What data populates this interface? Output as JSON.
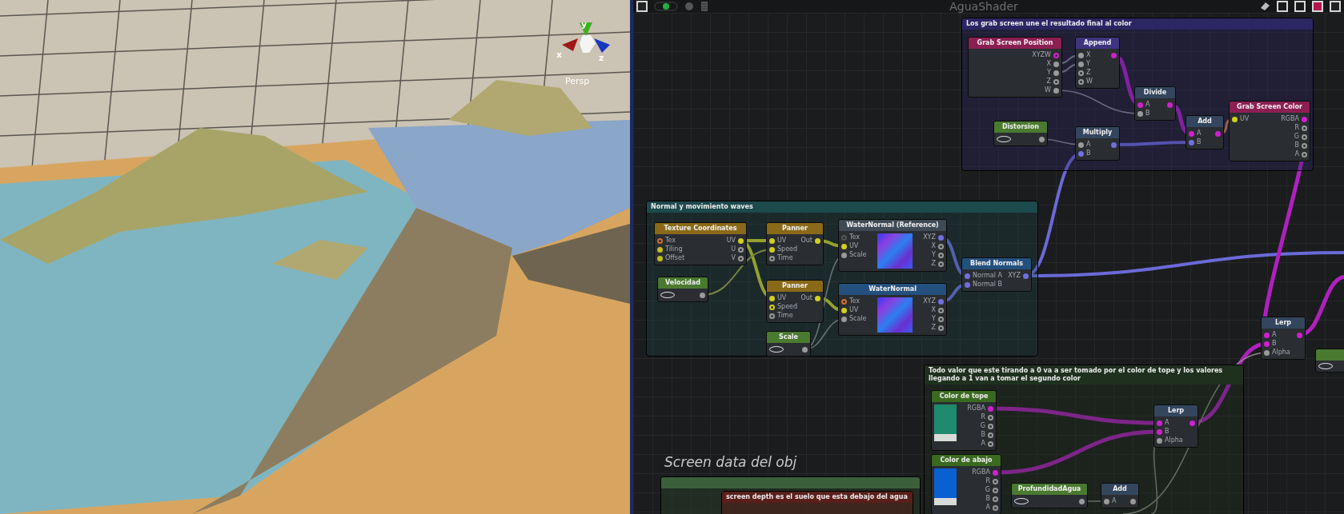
{
  "viewport": {
    "projection_label": "Persp",
    "gizmo_axes": [
      {
        "label": "y"
      },
      {
        "label": "x"
      },
      {
        "label": "z"
      }
    ]
  },
  "editor": {
    "title": "AguaShader"
  },
  "groups": [
    {
      "title": "Los grab screen une el resultado final al color",
      "color": "#2c2664"
    },
    {
      "title": "Normal y movimiento waves",
      "color": "#1d4a4c"
    },
    {
      "title": "Todo valor que este tirando a 0 va a ser tomado por el color de tope y los valores llegando a 1 van a tomar el segundo color",
      "color": "#1f301f"
    },
    {
      "color": "#3b5f3b"
    },
    {
      "title": "screen depth es el suelo que esta debajo del agua",
      "color": "#5a1f1a"
    }
  ],
  "floating_label": "Screen data del obj",
  "nodes": [
    {
      "kind": "basic",
      "title": "Grab Screen Position",
      "color": "#8c1f52",
      "outputs": [
        {
          "label": "XYZW",
          "color": "#d020d0",
          "connected": false
        },
        {
          "label": "X",
          "color": "#9a9a9a",
          "connected": true
        },
        {
          "label": "Y",
          "color": "#9a9a9a",
          "connected": true
        },
        {
          "label": "Z",
          "color": "#9a9a9a",
          "connected": false
        },
        {
          "label": "W",
          "color": "#9a9a9a",
          "connected": true
        }
      ]
    },
    {
      "kind": "basic",
      "title": "Append",
      "color": "#3e3480",
      "inputs": [
        {
          "label": "X",
          "color": "#9a9a9a",
          "connected": true
        },
        {
          "label": "Y",
          "color": "#9a9a9a",
          "connected": true
        },
        {
          "label": "Z",
          "color": "#9a9a9a",
          "connected": false
        },
        {
          "label": "W",
          "color": "#9a9a9a",
          "connected": false
        }
      ],
      "outputs": [
        {
          "color": "#d020d0",
          "connected": true
        }
      ]
    },
    {
      "kind": "basic",
      "title": "Divide",
      "color": "#34465e",
      "inputs": [
        {
          "label": "A",
          "color": "#d020d0",
          "connected": true
        },
        {
          "label": "B",
          "color": "#9a9a9a",
          "connected": true
        }
      ],
      "outputs": [
        {
          "color": "#d020d0",
          "connected": true
        }
      ]
    },
    {
      "kind": "basic",
      "title": "Add",
      "color": "#34465e",
      "inputs": [
        {
          "label": "A",
          "color": "#d020d0",
          "connected": true
        },
        {
          "label": "B",
          "color": "#7070e0",
          "connected": true
        }
      ],
      "outputs": [
        {
          "color": "#d020d0",
          "connected": true
        }
      ]
    },
    {
      "kind": "basic",
      "title": "Grab Screen Color",
      "color": "#8c1f52",
      "inputs": [
        {
          "label": "UV",
          "color": "#d0d020",
          "connected": true
        }
      ],
      "outputs": [
        {
          "label": "RGBA",
          "color": "#d020d0",
          "connected": true
        },
        {
          "label": "R",
          "color": "#9a9a9a",
          "connected": false
        },
        {
          "label": "G",
          "color": "#9a9a9a",
          "connected": false
        },
        {
          "label": "B",
          "color": "#9a9a9a",
          "connected": false
        },
        {
          "label": "A",
          "color": "#9a9a9a",
          "connected": false
        }
      ]
    },
    {
      "kind": "value",
      "title": "Distorsion",
      "color": "#4a7a30",
      "outputs": [
        {
          "color": "#9a9a9a",
          "connected": true
        }
      ]
    },
    {
      "kind": "basic",
      "title": "Multiply",
      "color": "#34465e",
      "inputs": [
        {
          "label": "A",
          "color": "#9a9a9a",
          "connected": true
        },
        {
          "label": "B",
          "color": "#7070e0",
          "connected": true
        }
      ],
      "outputs": [
        {
          "color": "#7070e0",
          "connected": true
        }
      ]
    },
    {
      "kind": "basic",
      "title": "Texture Coordinates",
      "color": "#8a6a18",
      "inputs": [
        {
          "label": "Tex",
          "color": "#d07030",
          "connected": false
        },
        {
          "label": "Tiling",
          "color": "#c0c020",
          "connected": true
        },
        {
          "label": "Offset",
          "color": "#c0c020",
          "connected": true
        }
      ],
      "outputs": [
        {
          "label": "UV",
          "color": "#d0d020",
          "connected": true
        },
        {
          "label": "U",
          "color": "#9a9a9a",
          "connected": false
        },
        {
          "label": "V",
          "color": "#9a9a9a",
          "connected": false
        }
      ]
    },
    {
      "kind": "value",
      "title": "Velocidad",
      "color": "#4a7a30",
      "outputs": [
        {
          "color": "#9a9a9a",
          "connected": true
        }
      ]
    },
    {
      "kind": "basic",
      "title": "Panner",
      "color": "#8a6a18",
      "inputs": [
        {
          "label": "UV",
          "color": "#d0d020",
          "connected": true
        },
        {
          "label": "Speed",
          "color": "#d0d020",
          "connected": true
        },
        {
          "label": "Time",
          "color": "#9a9a9a",
          "connected": false
        }
      ],
      "outputs": [
        {
          "label": "Out",
          "color": "#d0d020",
          "connected": true
        }
      ]
    },
    {
      "kind": "basic",
      "title": "Panner",
      "color": "#8a6a18",
      "inputs": [
        {
          "label": "UV",
          "color": "#d0d020",
          "connected": true
        },
        {
          "label": "Speed",
          "color": "#d0d020",
          "connected": false
        },
        {
          "label": "Time",
          "color": "#9a9a9a",
          "connected": false
        }
      ],
      "outputs": [
        {
          "label": "Out",
          "color": "#d0d020",
          "connected": true
        }
      ]
    },
    {
      "kind": "value",
      "title": "Scale",
      "color": "#4a7a30",
      "outputs": [
        {
          "color": "#9a9a9a",
          "connected": true
        }
      ]
    },
    {
      "kind": "texture",
      "title": "WaterNormal (Reference)",
      "color": "#3e4a54",
      "inputs": [
        {
          "label": "Tex",
          "color": "#555555",
          "connected": false
        },
        {
          "label": "UV",
          "color": "#d0d020",
          "connected": true
        },
        {
          "label": "Scale",
          "color": "#9a9a9a",
          "connected": true
        }
      ],
      "outputs": [
        {
          "label": "XYZ",
          "color": "#7070e0",
          "connected": true
        },
        {
          "label": "X",
          "color": "#9a9a9a",
          "connected": false
        },
        {
          "label": "Y",
          "color": "#9a9a9a",
          "connected": false
        },
        {
          "label": "Z",
          "color": "#9a9a9a",
          "connected": false
        }
      ]
    },
    {
      "kind": "texture",
      "title": "WaterNormal",
      "color": "#24507e",
      "inputs": [
        {
          "label": "Tex",
          "color": "#d07030",
          "connected": false
        },
        {
          "label": "UV",
          "color": "#d0d020",
          "connected": true
        },
        {
          "label": "Scale",
          "color": "#9a9a9a",
          "connected": true
        }
      ],
      "outputs": [
        {
          "label": "XYZ",
          "color": "#7070e0",
          "connected": true
        },
        {
          "label": "X",
          "color": "#9a9a9a",
          "connected": false
        },
        {
          "label": "Y",
          "color": "#9a9a9a",
          "connected": false
        },
        {
          "label": "Z",
          "color": "#9a9a9a",
          "connected": false
        }
      ]
    },
    {
      "kind": "basic",
      "title": "Blend Normals",
      "color": "#24507e",
      "inputs": [
        {
          "label": "Normal A",
          "color": "#7070e0",
          "connected": true
        },
        {
          "label": "Normal B",
          "color": "#7070e0",
          "connected": true
        }
      ],
      "outputs": [
        {
          "label": "XYZ",
          "color": "#7070e0",
          "connected": true
        }
      ]
    },
    {
      "kind": "basic",
      "title": "Lerp",
      "color": "#34465e",
      "inputs": [
        {
          "label": "A",
          "color": "#d020d0",
          "connected": true
        },
        {
          "label": "B",
          "color": "#d020d0",
          "connected": true
        },
        {
          "label": "Alpha",
          "color": "#9a9a9a",
          "connected": true
        }
      ],
      "outputs": [
        {
          "color": "#d020d0",
          "connected": true
        }
      ]
    },
    {
      "kind": "value",
      "color": "#4a7a30"
    },
    {
      "kind": "swatch",
      "title": "Color de tope",
      "color": "#3a6a20",
      "swatch": {
        "color": "#1e8a6e"
      },
      "outputs": [
        {
          "label": "RGBA",
          "color": "#d020d0",
          "connected": true
        },
        {
          "label": "R",
          "color": "#9a9a9a",
          "connected": false
        },
        {
          "label": "G",
          "color": "#9a9a9a",
          "connected": false
        },
        {
          "label": "B",
          "color": "#9a9a9a",
          "connected": false
        },
        {
          "label": "A",
          "color": "#9a9a9a",
          "connected": false
        }
      ]
    },
    {
      "kind": "swatch",
      "title": "Color de abajo",
      "color": "#3a6a20",
      "swatch": {
        "color": "#0a60d0"
      },
      "outputs": [
        {
          "label": "RGBA",
          "color": "#d020d0",
          "connected": true
        },
        {
          "label": "R",
          "color": "#9a9a9a",
          "connected": false
        },
        {
          "label": "G",
          "color": "#9a9a9a",
          "connected": false
        },
        {
          "label": "B",
          "color": "#9a9a9a",
          "connected": false
        },
        {
          "label": "A",
          "color": "#9a9a9a",
          "connected": false
        }
      ]
    },
    {
      "kind": "value",
      "title": "ProfundidadAgua",
      "color": "#4a7a30",
      "outputs": [
        {
          "color": "#9a9a9a",
          "connected": true
        }
      ]
    },
    {
      "kind": "basic",
      "title": "Add",
      "color": "#34465e",
      "inputs": [
        {
          "label": "A",
          "color": "#9a9a9a",
          "connected": true
        }
      ],
      "outputs": [
        {
          "color": "#9a9a9a",
          "connected": true
        }
      ]
    },
    {
      "kind": "basic",
      "title": "Lerp",
      "color": "#34465e",
      "inputs": [
        {
          "label": "A",
          "color": "#d020d0",
          "connected": true
        },
        {
          "label": "B",
          "color": "#d020d0",
          "connected": true
        },
        {
          "label": "Alpha",
          "color": "#9a9a9a",
          "connected": true
        }
      ],
      "outputs": [
        {
          "color": "#d020d0",
          "connected": true
        }
      ]
    }
  ]
}
